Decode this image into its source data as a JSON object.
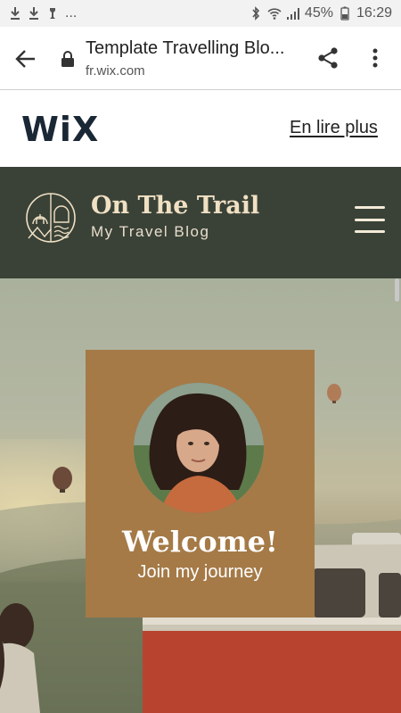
{
  "status_bar": {
    "battery": "45%",
    "time": "16:29",
    "overflow": "..."
  },
  "browser": {
    "page_title": "Template Travelling Blo...",
    "url": "fr.wix.com"
  },
  "wix_banner": {
    "logo": "WiX",
    "read_more": "En lire plus"
  },
  "site": {
    "title": "On The Trail",
    "subtitle": "My Travel Blog"
  },
  "hero": {
    "welcome_title": "Welcome!",
    "welcome_subtitle": "Join my journey"
  },
  "colors": {
    "header_bg": "#3a4237",
    "card_bg": "#a57a47",
    "title_cream": "#f0e0c4",
    "wix_dark": "#1a2735"
  },
  "icons": [
    "download-icon",
    "download-icon",
    "notification-icon",
    "bluetooth-icon",
    "wifi-icon",
    "signal-icon",
    "battery-icon",
    "back-arrow-icon",
    "lock-icon",
    "share-icon",
    "more-vert-icon",
    "hamburger-menu-icon",
    "site-logo-icon"
  ]
}
